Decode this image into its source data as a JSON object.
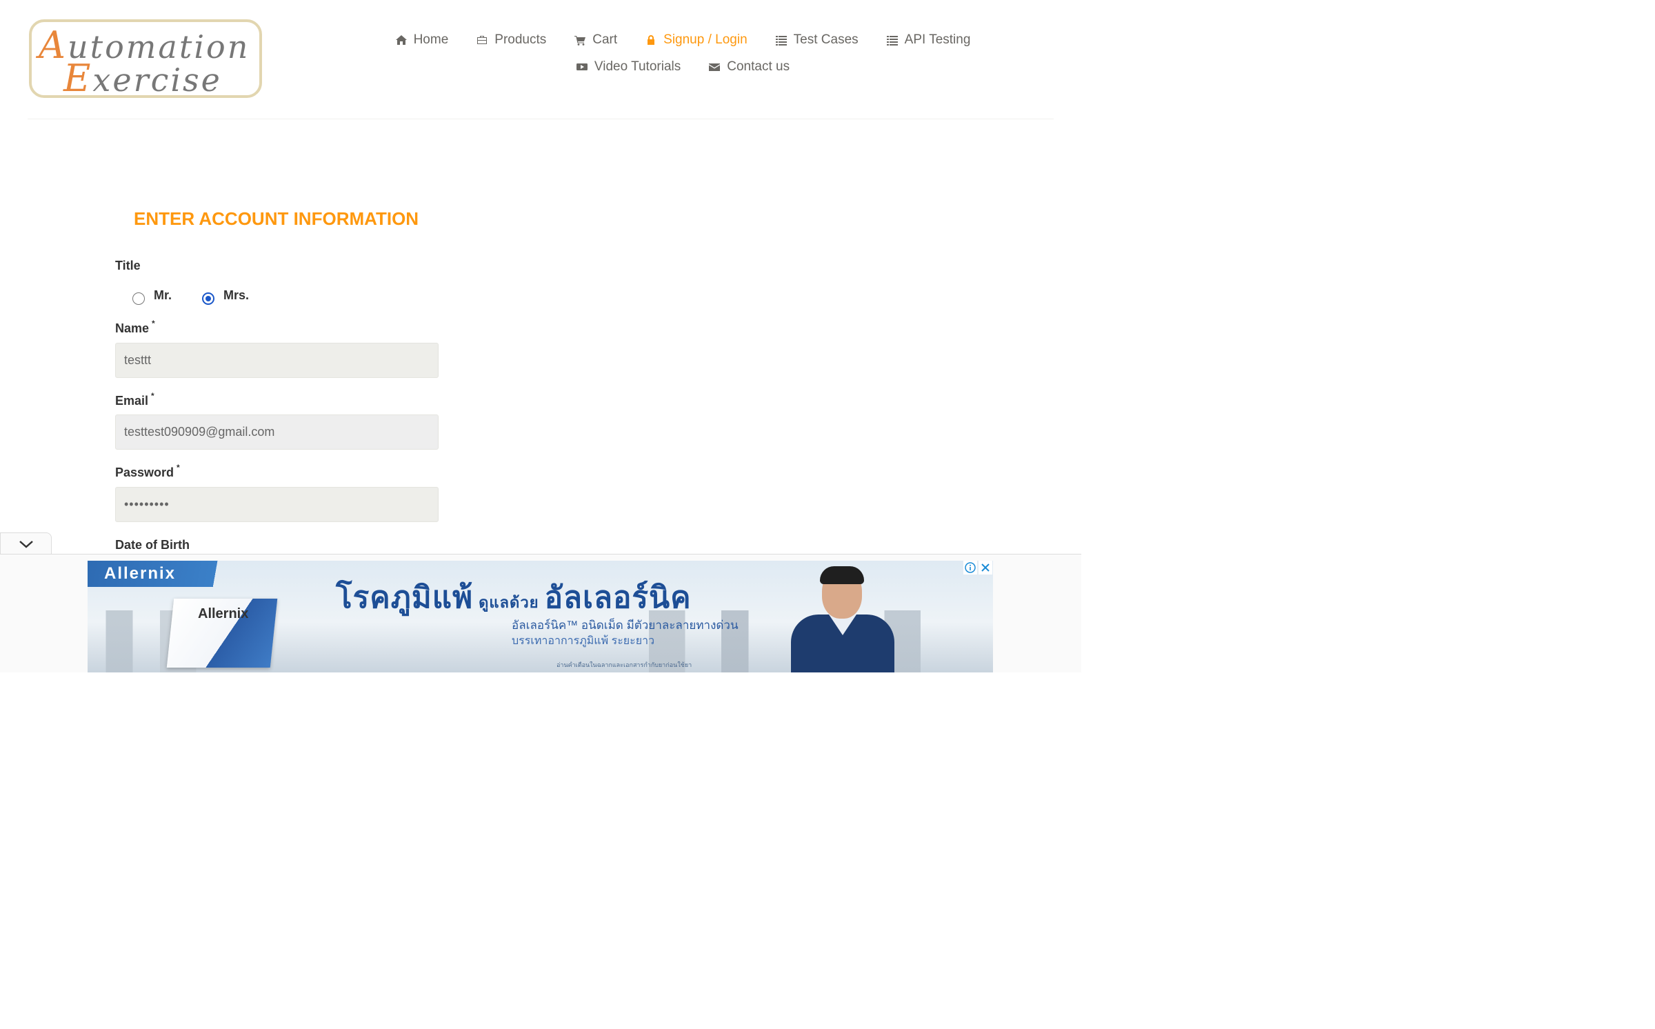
{
  "header": {
    "logo": {
      "line1": "Automation",
      "line2": "Exercise"
    },
    "nav": [
      {
        "label": "Home",
        "icon": "home-icon",
        "active": false
      },
      {
        "label": "Products",
        "icon": "briefcase-icon",
        "active": false
      },
      {
        "label": "Cart",
        "icon": "cart-icon",
        "active": false
      },
      {
        "label": "Signup / Login",
        "icon": "lock-icon",
        "active": true
      },
      {
        "label": "Test Cases",
        "icon": "list-icon",
        "active": false
      },
      {
        "label": "API Testing",
        "icon": "list-icon",
        "active": false
      },
      {
        "label": "Video Tutorials",
        "icon": "youtube-play-icon",
        "active": false
      },
      {
        "label": "Contact us",
        "icon": "envelope-icon",
        "active": false
      }
    ]
  },
  "form": {
    "title": "ENTER ACCOUNT INFORMATION",
    "title_label": "Title",
    "title_options": [
      {
        "label": "Mr.",
        "checked": false
      },
      {
        "label": "Mrs.",
        "checked": true
      }
    ],
    "name_label": "Name",
    "name_value": "testtt",
    "email_label": "Email",
    "email_value": "testtest090909@gmail.com",
    "password_label": "Password",
    "password_value": "•••••••••",
    "required_mark": "*",
    "dob_label": "Date of Birth"
  },
  "ad": {
    "brand": "Allernix",
    "product_text": "Allernix",
    "headline": "โรคภูมิแพ้",
    "headline_small": "ดูแลด้วย",
    "headline_tail": "อัลเลอร์นิค",
    "sub1": "อัลเลอร์นิค™ อนิดเม็ด มีตัวยาละลายทางด่วน",
    "sub2": "บรรเทาอาการภูมิแพ้ ระยะยาว",
    "fine_print": "อ่านคำเตือนในฉลากและเอกสารกำกับยาก่อนใช้ยา"
  },
  "colors": {
    "accent": "#fe980f",
    "nav_text": "#696763",
    "field_bg": "#eeeeea",
    "radio_checked": "#1a57c9"
  }
}
